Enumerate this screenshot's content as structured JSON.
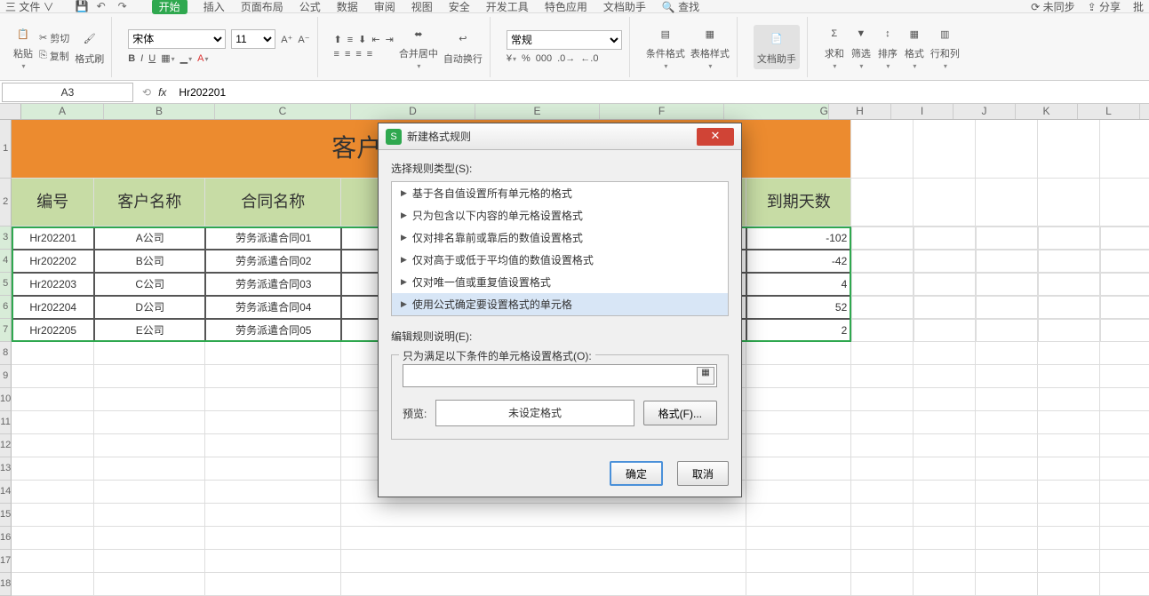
{
  "menubar": {
    "file": "三 文件 ∨",
    "tabs": [
      "开始",
      "插入",
      "页面布局",
      "公式",
      "数据",
      "审阅",
      "视图",
      "安全",
      "开发工具",
      "特色应用",
      "文档助手"
    ],
    "search_placeholder": "查找",
    "right": [
      "未同步",
      "分享",
      "批"
    ]
  },
  "ribbon": {
    "paste": "粘贴",
    "cut": "剪切",
    "copy": "复制",
    "format_painter": "格式刷",
    "font_name": "宋体",
    "font_size": "11",
    "merge_center": "合并居中",
    "wrap": "自动换行",
    "number_format": "常规",
    "cond_fmt": "条件格式",
    "table_style": "表格样式",
    "doc_helper": "文档助手",
    "sum": "求和",
    "filter": "筛选",
    "sort": "排序",
    "format": "格式",
    "rowcol": "行和列"
  },
  "formula_bar": {
    "name_box": "A3",
    "fx": "fx",
    "value": "Hr202201"
  },
  "sheet": {
    "columns": [
      "A",
      "B",
      "C",
      "D",
      "E",
      "F",
      "G",
      "H",
      "I",
      "J",
      "K",
      "L"
    ],
    "title": "客户",
    "headers": {
      "A": "编号",
      "B": "客户名称",
      "C": "合同名称",
      "G": "到期天数"
    },
    "rows": [
      {
        "A": "Hr202201",
        "B": "A公司",
        "C": "劳务派遣合同01",
        "G": "-102"
      },
      {
        "A": "Hr202202",
        "B": "B公司",
        "C": "劳务派遣合同02",
        "G": "-42"
      },
      {
        "A": "Hr202203",
        "B": "C公司",
        "C": "劳务派遣合同03",
        "G": "4"
      },
      {
        "A": "Hr202204",
        "B": "D公司",
        "C": "劳务派遣合同04",
        "G": "52"
      },
      {
        "A": "Hr202205",
        "B": "E公司",
        "C": "劳务派遣合同05",
        "G": "2"
      }
    ],
    "row_numbers": [
      "1",
      "2",
      "3",
      "4",
      "5",
      "6",
      "7",
      "8",
      "9",
      "10",
      "11",
      "12",
      "13",
      "14",
      "15",
      "16",
      "17",
      "18"
    ]
  },
  "dialog": {
    "title": "新建格式规则",
    "select_label": "选择规则类型(S):",
    "rules": [
      "基于各自值设置所有单元格的格式",
      "只为包含以下内容的单元格设置格式",
      "仅对排名靠前或靠后的数值设置格式",
      "仅对高于或低于平均值的数值设置格式",
      "仅对唯一值或重复值设置格式",
      "使用公式确定要设置格式的单元格"
    ],
    "edit_label": "编辑规则说明(E):",
    "fieldset_label": "只为满足以下条件的单元格设置格式(O):",
    "preview_label": "预览:",
    "preview_text": "未设定格式",
    "format_btn": "格式(F)...",
    "ok": "确定",
    "cancel": "取消"
  }
}
